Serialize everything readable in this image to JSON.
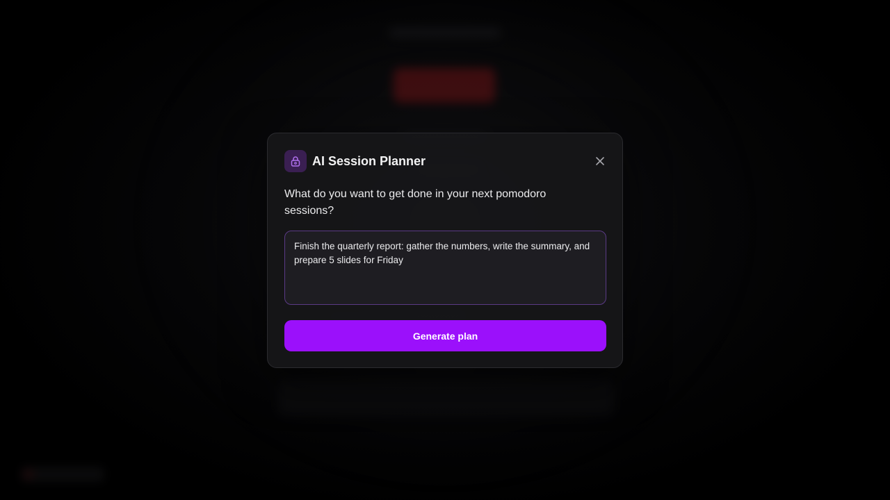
{
  "modal": {
    "title": "AI Session Planner",
    "icon": "lock-sparkle-icon",
    "close_icon": "close-icon",
    "prompt_label": "What do you want to get done in your next pomodoro sessions?",
    "input_value": "Finish the quarterly report: gather the numbers, write the summary, and prepare 5 slides for Friday",
    "generate_label": "Generate plan"
  },
  "colors": {
    "accent": "#9b10fb",
    "icon_bg": "#3a1f52",
    "input_border": "#5b3a86",
    "background_start_button": "#6a1417"
  }
}
